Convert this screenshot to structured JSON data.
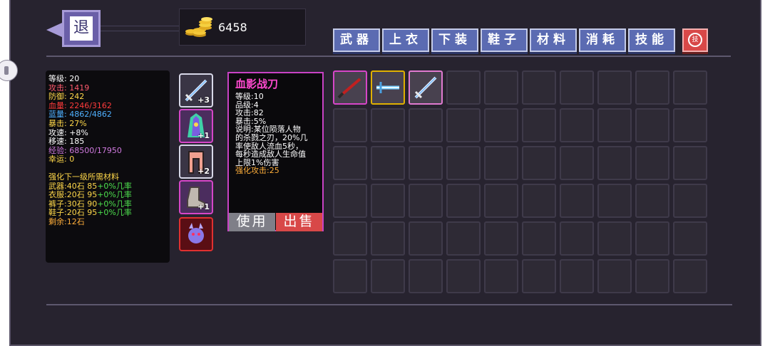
{
  "header": {
    "back_label": "退",
    "gold": "6458"
  },
  "tabs": [
    {
      "label": "武器"
    },
    {
      "label": "上衣"
    },
    {
      "label": "下装"
    },
    {
      "label": "鞋子"
    },
    {
      "label": "材料"
    },
    {
      "label": "消耗"
    },
    {
      "label": "技能"
    }
  ],
  "skill_button_label": "技",
  "stats": {
    "level": "等级: 20",
    "attack": "攻击: 1419",
    "defense": "防御: 242",
    "hp": "血量: 2246/3162",
    "mp": "蓝量: 4862/4862",
    "crit": "暴击: 27%",
    "attack_speed": "攻速: +8%",
    "move_speed": "移速: 185",
    "exp": "经验: 68500/17950",
    "luck": "幸运: 0",
    "upgrade_title": "强化下一级所需材料",
    "weapon_label": "武器:40石 85",
    "weapon_rate": "+0%几率",
    "clothes_label": "衣服:20石 95",
    "clothes_rate": "+0%几率",
    "pants_label": "裤子:30石 90",
    "pants_rate": "+0%几率",
    "shoes_label": "鞋子:20石 95",
    "shoes_rate": "+0%几率",
    "remaining": "剩余:12石"
  },
  "colors": {
    "white": "#ffffff",
    "red": "#ff5b6e",
    "blue": "#4fb0ff",
    "yellow": "#ffd84a",
    "purple": "#d07adf",
    "green": "#4ee04e",
    "orange": "#ffae3a"
  },
  "equipment": [
    {
      "name": "sword-icon",
      "plus": "+3",
      "tag": "USE"
    },
    {
      "name": "robe-icon",
      "plus": "+1",
      "tag": "USE"
    },
    {
      "name": "pants-icon",
      "plus": "+2",
      "tag": "USE"
    },
    {
      "name": "boot-icon",
      "plus": "+1",
      "tag": "USE"
    },
    {
      "name": "pet-icon",
      "plus": "",
      "tag": ""
    }
  ],
  "item_card": {
    "title": "血影战刀",
    "level": "等级:10",
    "grade": "品级:4",
    "attack": "攻击:82",
    "crit": "暴击:5%",
    "desc_1": "说明:某位陨落人物",
    "desc_2": "的杀戮之刃，20%几",
    "desc_3": "率使敌人流血5秒，",
    "desc_4": "每秒造成敌人生命值",
    "desc_5": "上限1%伤害",
    "enhance": "强化攻击:25",
    "use_label": "使用",
    "sell_label": "出售"
  },
  "inventory": {
    "rows": 6,
    "cols": 10,
    "items": [
      {
        "index": 0,
        "name": "blood-blade-icon",
        "rarity": "pink"
      },
      {
        "index": 1,
        "name": "ice-sword-icon",
        "rarity": "gold"
      },
      {
        "index": 2,
        "name": "rainbow-sword-icon",
        "rarity": "rainbow"
      }
    ]
  }
}
